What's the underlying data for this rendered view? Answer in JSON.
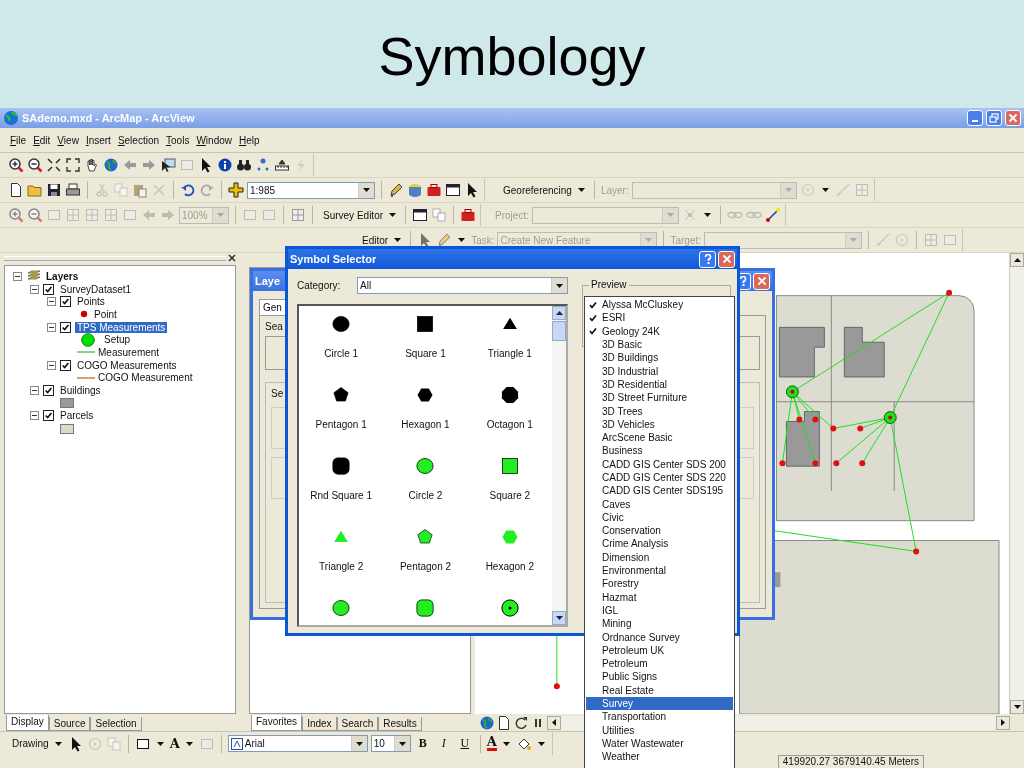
{
  "slide_title": "Symbology",
  "window": {
    "title": "SAdemo.mxd - ArcMap - ArcView"
  },
  "menu": [
    "File",
    "Edit",
    "View",
    "Insert",
    "Selection",
    "Tools",
    "Window",
    "Help"
  ],
  "toolbars": {
    "scale": "1:985",
    "georeferencing": "Georeferencing",
    "layer_label": "Layer:",
    "zoom": "100%",
    "survey_editor": "Survey Editor",
    "project_label": "Project:",
    "editor": "Editor",
    "task_label": "Task:",
    "task": "Create New Feature",
    "target_label": "Target:"
  },
  "toc": {
    "root_label": "Layers",
    "root_expanded": true,
    "layers": [
      {
        "label": "SurveyDataset1",
        "checked": true,
        "expanded": true,
        "selected": false,
        "children": [
          {
            "label": "Points",
            "checked": true,
            "expanded": true,
            "selected": false,
            "legend": [
              {
                "label": "Point",
                "kind": "marker",
                "color": "#cc0000"
              }
            ]
          },
          {
            "label": "TPS Measurements",
            "checked": true,
            "expanded": true,
            "selected": true,
            "legend": [
              {
                "label": "Setup",
                "kind": "big-marker",
                "color": "#00e000"
              },
              {
                "label": "Measurement",
                "kind": "line",
                "color": "#77dd77"
              }
            ]
          },
          {
            "label": "COGO Measurements",
            "checked": true,
            "expanded": true,
            "selected": false,
            "legend": [
              {
                "label": "COGO Measurement",
                "kind": "line",
                "color": "#d9a060"
              }
            ]
          }
        ]
      },
      {
        "label": "Buildings",
        "checked": true,
        "expanded": true,
        "selected": false,
        "legend": [
          {
            "kind": "fill",
            "color": "#999999"
          }
        ]
      },
      {
        "label": "Parcels",
        "checked": true,
        "expanded": true,
        "selected": false,
        "legend": [
          {
            "kind": "fill",
            "color": "#d9dccb"
          }
        ]
      }
    ],
    "tabs": [
      {
        "label": "Display",
        "selected": true
      },
      {
        "label": "Source",
        "selected": false
      },
      {
        "label": "Selection",
        "selected": false
      }
    ]
  },
  "side_panel": {
    "tabs": [
      {
        "label": "Favorites",
        "selected": true
      },
      {
        "label": "Index",
        "selected": false
      },
      {
        "label": "Search",
        "selected": false
      },
      {
        "label": "Results",
        "selected": false
      }
    ]
  },
  "layer_dialog": {
    "title": "Laye",
    "tab": "Gen",
    "label_1": "Sea",
    "label_2": "Se"
  },
  "symbol_selector": {
    "title": "Symbol Selector",
    "category_label": "Category:",
    "category": "All",
    "preview_label": "Preview",
    "symbols": [
      {
        "label": "Circle 1",
        "kind": "circle",
        "color": "#000000"
      },
      {
        "label": "Square 1",
        "kind": "square",
        "color": "#000000"
      },
      {
        "label": "Triangle 1",
        "kind": "triangle",
        "color": "#000000"
      },
      {
        "label": "Pentagon 1",
        "kind": "pentagon",
        "color": "#000000"
      },
      {
        "label": "Hexagon 1",
        "kind": "hexagon",
        "color": "#000000"
      },
      {
        "label": "Octagon 1",
        "kind": "octagon",
        "color": "#000000"
      },
      {
        "label": "Rnd Square 1",
        "kind": "rounded-square",
        "color": "#000000"
      },
      {
        "label": "Circle 2",
        "kind": "circle",
        "color": "#22ee22"
      },
      {
        "label": "Square 2",
        "kind": "square",
        "color": "#22ee22"
      },
      {
        "label": "Triangle 2",
        "kind": "triangle",
        "color": "#22ee22"
      },
      {
        "label": "Pentagon 2",
        "kind": "pentagon",
        "color": "#22ee22"
      },
      {
        "label": "Hexagon 2",
        "kind": "hexagon",
        "color": "#22ee22"
      },
      {
        "kind": "circle",
        "color": "#22ee22"
      },
      {
        "kind": "rounded-square",
        "color": "#22ee22"
      },
      {
        "kind": "dotted-circle",
        "color": "#22ee22"
      }
    ]
  },
  "style_list": [
    {
      "label": "Alyssa McCluskey",
      "checked": true,
      "selected": false
    },
    {
      "label": "ESRI",
      "checked": true,
      "selected": false
    },
    {
      "label": "Geology 24K",
      "checked": true,
      "selected": false
    },
    {
      "label": "3D Basic",
      "checked": false,
      "selected": false
    },
    {
      "label": "3D Buildings",
      "checked": false,
      "selected": false
    },
    {
      "label": "3D Industrial",
      "checked": false,
      "selected": false
    },
    {
      "label": "3D Residential",
      "checked": false,
      "selected": false
    },
    {
      "label": "3D Street Furniture",
      "checked": false,
      "selected": false
    },
    {
      "label": "3D Trees",
      "checked": false,
      "selected": false
    },
    {
      "label": "3D Vehicles",
      "checked": false,
      "selected": false
    },
    {
      "label": "ArcScene Basic",
      "checked": false,
      "selected": false
    },
    {
      "label": "Business",
      "checked": false,
      "selected": false
    },
    {
      "label": "CADD GIS Center SDS 200",
      "checked": false,
      "selected": false
    },
    {
      "label": "CADD GIS Center SDS 220",
      "checked": false,
      "selected": false
    },
    {
      "label": "CADD GIS Center SDS195",
      "checked": false,
      "selected": false
    },
    {
      "label": "Caves",
      "checked": false,
      "selected": false
    },
    {
      "label": "Civic",
      "checked": false,
      "selected": false
    },
    {
      "label": "Conservation",
      "checked": false,
      "selected": false
    },
    {
      "label": "Crime Analysis",
      "checked": false,
      "selected": false
    },
    {
      "label": "Dimension",
      "checked": false,
      "selected": false
    },
    {
      "label": "Environmental",
      "checked": false,
      "selected": false
    },
    {
      "label": "Forestry",
      "checked": false,
      "selected": false
    },
    {
      "label": "Hazmat",
      "checked": false,
      "selected": false
    },
    {
      "label": "IGL",
      "checked": false,
      "selected": false
    },
    {
      "label": "Mining",
      "checked": false,
      "selected": false
    },
    {
      "label": "Ordnance Survey",
      "checked": false,
      "selected": false
    },
    {
      "label": "Petroleum UK",
      "checked": false,
      "selected": false
    },
    {
      "label": "Petroleum",
      "checked": false,
      "selected": false
    },
    {
      "label": "Public Signs",
      "checked": false,
      "selected": false
    },
    {
      "label": "Real Estate",
      "checked": false,
      "selected": false
    },
    {
      "label": "Survey",
      "checked": false,
      "selected": true
    },
    {
      "label": "Transportation",
      "checked": false,
      "selected": false
    },
    {
      "label": "Utilities",
      "checked": false,
      "selected": false
    },
    {
      "label": "Water Wastewater",
      "checked": false,
      "selected": false
    },
    {
      "label": "Weather",
      "checked": false,
      "selected": false
    }
  ],
  "drawing_toolbar": {
    "label": "Drawing",
    "text_tool": "A",
    "font": "Arial",
    "size": "10",
    "bold": "B",
    "italic": "I",
    "underline": "U",
    "font_color": "A"
  },
  "status_bar": {
    "coordinates": "419920.27  3679140.45 Meters"
  }
}
